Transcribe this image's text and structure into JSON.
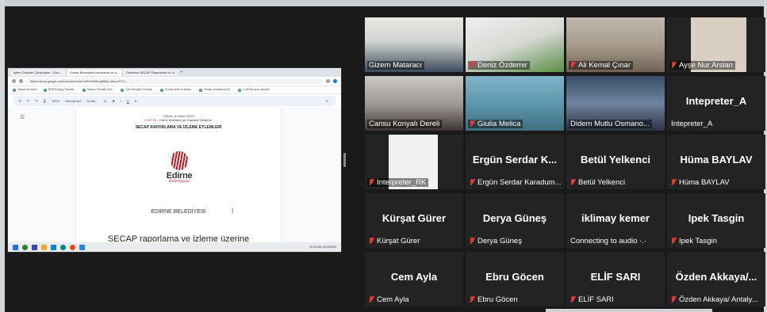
{
  "shared_screen": {
    "tabs": [
      "İşlem Grupları Çalışmaları - Goo...",
      "Edirne Belediyesi raporlama ve iz...",
      "Dantelen SECAP Raporlama ve İz..."
    ],
    "url": "https://docs.google.com/document/d/1mFKrWdkng9Mjsu-Bes-IGTC...",
    "bookmarks": [
      "Import favorites",
      "Shift Energy Transiti...",
      "Nature Climate Cha...",
      "Çok Seviyeli Yönetiş...",
      "Enerji nedir ve Baza...",
      "Secap Guidebook B...",
      "CoM Europe reportin..."
    ],
    "doc_toolbar": [
      "100%",
      "Normal text",
      "Centu...",
      "11"
    ],
    "document": {
      "date": "Türkan, 8 Kasım 2023",
      "subtitle_highlight": "ICLEI TR",
      "subtitle_rest": " – Edirne Belediyesi için Kapasite Geliştirme",
      "title": "SECAP RAPORLAMA VE İZLEME EYLEMLERİ",
      "logo_word": "Edirne",
      "logo_script": "Belediyesi",
      "organization": "EDİRNE BELEDİYESİ",
      "heading": "SECAP raporlama ve izleme üzerine"
    },
    "clock": "10:16 AM  11/10/2023"
  },
  "participants": [
    {
      "name": "Gizem Mataracı",
      "muted": false,
      "has_video": true,
      "speaking": true
    },
    {
      "name": "Deniz Özdemir",
      "muted": true,
      "has_video": true,
      "speaking": false
    },
    {
      "name": "Ali Kemal Çınar",
      "muted": true,
      "has_video": true,
      "speaking": false
    },
    {
      "name": "Ayşe Nur Arslan",
      "muted": true,
      "has_video": true,
      "speaking": false
    },
    {
      "name": "Cansu Konyalı Dereli",
      "muted": false,
      "has_video": true,
      "speaking": false
    },
    {
      "name": "Giulia Melica",
      "muted": true,
      "has_video": true,
      "speaking": false
    },
    {
      "name": "Didem Mutlu Osmano...",
      "muted": false,
      "has_video": true,
      "speaking": false
    },
    {
      "name": "Intepreter_A",
      "display": "Intepreter_A",
      "muted": false,
      "has_video": false,
      "speaking": false
    },
    {
      "name": "Interpreter_RK",
      "muted": true,
      "has_video": true,
      "speaking": false
    },
    {
      "name": "Ergün Serdar Karadum...",
      "display": "Ergün Serdar K...",
      "muted": true,
      "has_video": false,
      "speaking": false
    },
    {
      "name": "Betül Yelkenci",
      "display": "Betül Yelkenci",
      "muted": true,
      "has_video": false,
      "speaking": false
    },
    {
      "name": "Hüma BAYLAV",
      "display": "Hüma BAYLAV",
      "muted": true,
      "has_video": false,
      "speaking": false
    },
    {
      "name": "Kürşat Gürer",
      "display": "Kürşat Gürer",
      "muted": true,
      "has_video": false,
      "speaking": false
    },
    {
      "name": "Derya Güneş",
      "display": "Derya Güneş",
      "muted": true,
      "has_video": false,
      "speaking": false
    },
    {
      "name": "Connecting to audio ·.·",
      "display": "iklimay kemer",
      "muted": false,
      "has_video": false,
      "speaking": false
    },
    {
      "name": "Ipek Tasgin",
      "display": "Ipek Tasgin",
      "muted": true,
      "has_video": false,
      "speaking": false
    },
    {
      "name": "Cem Ayla",
      "display": "Cem Ayla",
      "muted": true,
      "has_video": false,
      "speaking": false
    },
    {
      "name": "Ebru Göcen",
      "display": "Ebru Göcen",
      "muted": true,
      "has_video": false,
      "speaking": false
    },
    {
      "name": "ELİF SARI",
      "display": "ELİF SARI",
      "muted": true,
      "has_video": false,
      "speaking": false
    },
    {
      "name": "Özden Akkaya/ Antaly...",
      "display": "Özden Akkaya/...",
      "muted": true,
      "has_video": false,
      "speaking": false
    }
  ],
  "colors": {
    "speaking_border": "#d6e65b",
    "mute_icon": "#e53935",
    "tile_bg": "#232323"
  }
}
